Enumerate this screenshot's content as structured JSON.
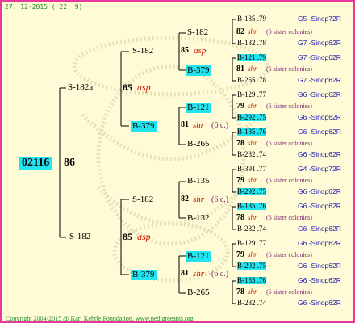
{
  "date": "27. 12-2015 ( 22: 9)",
  "root": {
    "id": "02116",
    "num": "86"
  },
  "gen1": [
    {
      "label": "S-182a",
      "num": "85",
      "tag": "asp"
    },
    {
      "label": "S-182",
      "num": "85",
      "tag": "asp"
    }
  ],
  "gen2": [
    {
      "label": "S-182",
      "num": "85",
      "tag": "asp"
    },
    {
      "label": "B-379",
      "num": "81",
      "tag": "shr",
      "note": "(6 c.)"
    },
    {
      "label": "S-182",
      "num": "82",
      "tag": "shr",
      "note": "(6 c.)"
    },
    {
      "label": "B-379",
      "num": "81",
      "tag": "shr",
      "note": "(6 c.)"
    }
  ],
  "gen3": [
    {
      "label": "S-182",
      "num": "82",
      "tag": "shr",
      "note": "(6 sister colonies)"
    },
    {
      "label": "B-379",
      "num": "81",
      "tag": "shr",
      "note": "(6 sister colonies)"
    },
    {
      "label": "B-121",
      "num": "79",
      "tag": "shr",
      "note": "(6 sister colonies)"
    },
    {
      "label": "B-265",
      "num": "78",
      "tag": "shr",
      "note": "(6 sister colonies)"
    },
    {
      "label": "B-135",
      "num": "79",
      "tag": "shr",
      "note": "(6 sister colonies)"
    },
    {
      "label": "B-132",
      "num": "78",
      "tag": "shr",
      "note": "(6 sister colonies)"
    },
    {
      "label": "B-121",
      "num": "79",
      "tag": "shr",
      "note": "(6 sister colonies)"
    },
    {
      "label": "B-265",
      "num": "78",
      "tag": "shr",
      "note": "(6 sister colonies)"
    }
  ],
  "gen4": [
    {
      "label": "B-135 .79",
      "code": "G5 -Sinop72R"
    },
    {
      "label": "B-132 .78",
      "code": "G7 -Sinop62R"
    },
    {
      "label": "B-121 .79",
      "code": "G7 -Sinop62R"
    },
    {
      "label": "B-265 .78",
      "code": "G7 -Sinop62R"
    },
    {
      "label": "B-129 .77",
      "code": "G6 -Sinop62R"
    },
    {
      "label": "B-292 .75",
      "code": "G6 -Sinop62R"
    },
    {
      "label": "B-135 .76",
      "code": "G6 -Sinop62R"
    },
    {
      "label": "B-282 .74",
      "code": "G6 -Sinop62R"
    },
    {
      "label": "B-391 .77",
      "code": "G4 -Sinop72R"
    },
    {
      "label": "B-292 .75",
      "code": "G6 -Sinop62R"
    },
    {
      "label": "B-135 .76",
      "code": "G6 -Sinop62R"
    },
    {
      "label": "B-282 .74",
      "code": "G6 -Sinop62R"
    },
    {
      "label": "B-129 .77",
      "code": "G6 -Sinop62R"
    },
    {
      "label": "B-292 .75",
      "code": "G6 -Sinop62R"
    },
    {
      "label": "B-135 .76",
      "code": "G6 -Sinop62R"
    },
    {
      "label": "B-282 .74",
      "code": "G6 -Sinop62R"
    }
  ],
  "copyright": "Copyright 2004-2015 @ Karl Kehrle Foundation.   www.pedigreeapis.org"
}
